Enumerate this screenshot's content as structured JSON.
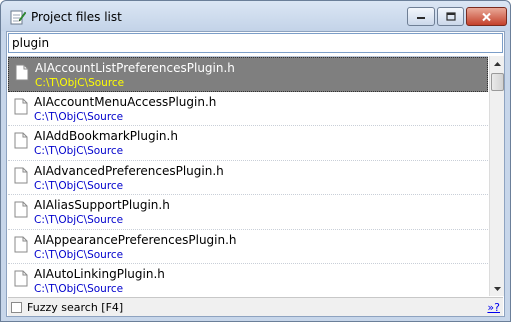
{
  "window": {
    "title": "Project files list",
    "icon": "edit-notepad-icon",
    "controls": [
      "minimize-icon",
      "maximize-icon",
      "close-icon"
    ]
  },
  "search": {
    "value": "plugin"
  },
  "files": [
    {
      "name": "AIAccountListPreferencesPlugin.h",
      "path": "C:\\T\\ObjC\\Source",
      "selected": true
    },
    {
      "name": "AIAccountMenuAccessPlugin.h",
      "path": "C:\\T\\ObjC\\Source",
      "selected": false
    },
    {
      "name": "AIAddBookmarkPlugin.h",
      "path": "C:\\T\\ObjC\\Source",
      "selected": false
    },
    {
      "name": "AIAdvancedPreferencesPlugin.h",
      "path": "C:\\T\\ObjC\\Source",
      "selected": false
    },
    {
      "name": "AIAliasSupportPlugin.h",
      "path": "C:\\T\\ObjC\\Source",
      "selected": false
    },
    {
      "name": "AIAppearancePreferencesPlugin.h",
      "path": "C:\\T\\ObjC\\Source",
      "selected": false
    },
    {
      "name": "AIAutoLinkingPlugin.h",
      "path": "C:\\T\\ObjC\\Source",
      "selected": false
    }
  ],
  "status": {
    "fuzzy_label": "Fuzzy search [F4]",
    "fuzzy_checked": false,
    "more_link": "»?"
  },
  "colors": {
    "selected_bg": "#7f7f7f",
    "selected_path": "#ffff00",
    "path": "#0000cc"
  }
}
